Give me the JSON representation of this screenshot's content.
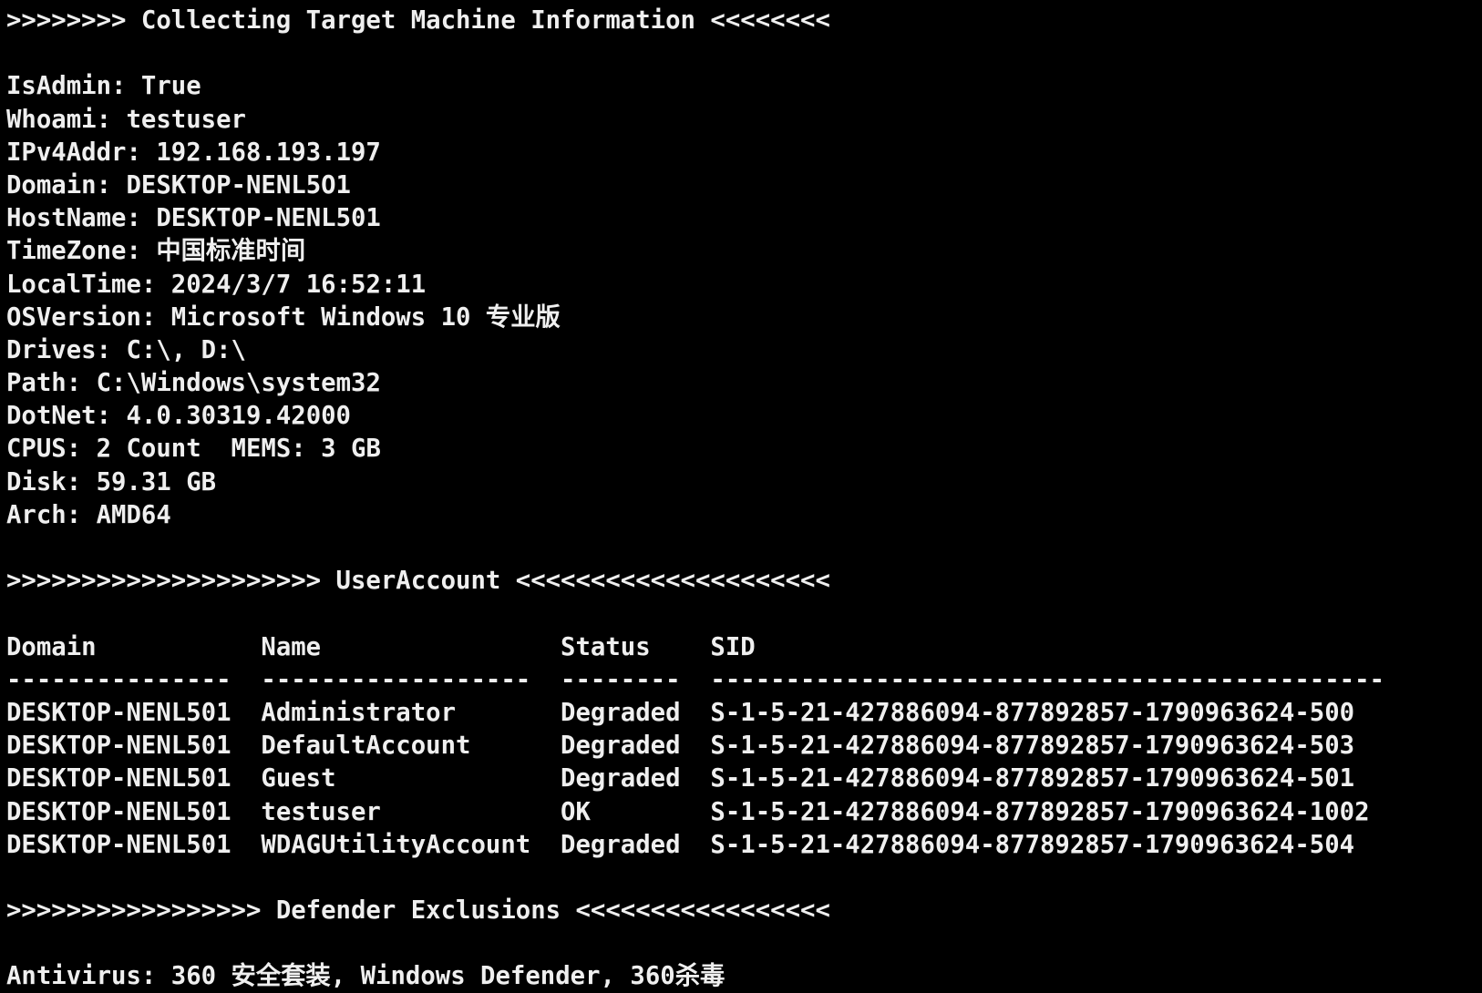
{
  "header": {
    "machine_info": ">>>>>>>> Collecting Target Machine Information <<<<<<<<",
    "user_account": ">>>>>>>>>>>>>>>>>>>>> UserAccount <<<<<<<<<<<<<<<<<<<<<",
    "defender": ">>>>>>>>>>>>>>>>> Defender Exclusions <<<<<<<<<<<<<<<<<"
  },
  "info": {
    "is_admin": {
      "key": "IsAdmin",
      "value": "True"
    },
    "whoami": {
      "key": "Whoami",
      "value": "testuser"
    },
    "ipv4": {
      "key": "IPv4Addr",
      "value": "192.168.193.197"
    },
    "domain": {
      "key": "Domain",
      "value": "DESKTOP-NENL5O1"
    },
    "hostname": {
      "key": "HostName",
      "value": "DESKTOP-NENL501"
    },
    "timezone": {
      "key": "TimeZone",
      "value": "中国标准时间"
    },
    "localtime": {
      "key": "LocalTime",
      "value": "2024/3/7 16:52:11"
    },
    "osversion": {
      "key": "OSVersion",
      "value": "Microsoft Windows 10 专业版"
    },
    "drives": {
      "key": "Drives",
      "value": "C:\\, D:\\"
    },
    "path": {
      "key": "Path",
      "value": "C:\\Windows\\system32"
    },
    "dotnet": {
      "key": "DotNet",
      "value": "4.0.30319.42000"
    },
    "cpus": {
      "key": "CPUS",
      "value": "2 Count"
    },
    "mems": {
      "key": "MEMS",
      "value": "3 GB"
    },
    "disk": {
      "key": "Disk",
      "value": "59.31 GB"
    },
    "arch": {
      "key": "Arch",
      "value": "AMD64"
    }
  },
  "accounts": {
    "header_line": "Domain           Name                Status    SID",
    "divider_line": "---------------  ------------------  --------  ---------------------------------------------",
    "rows": [
      "DESKTOP-NENL501  Administrator       Degraded  S-1-5-21-427886094-877892857-1790963624-500",
      "DESKTOP-NENL501  DefaultAccount      Degraded  S-1-5-21-427886094-877892857-1790963624-503",
      "DESKTOP-NENL501  Guest               Degraded  S-1-5-21-427886094-877892857-1790963624-501",
      "DESKTOP-NENL501  testuser            OK        S-1-5-21-427886094-877892857-1790963624-1002",
      "DESKTOP-NENL501  WDAGUtilityAccount  Degraded  S-1-5-21-427886094-877892857-1790963624-504"
    ]
  },
  "antivirus": {
    "key": "Antivirus",
    "value": "360 安全套装, Windows Defender, 360杀毒"
  },
  "colors": {
    "background": "#000000",
    "text": "#efefef"
  }
}
